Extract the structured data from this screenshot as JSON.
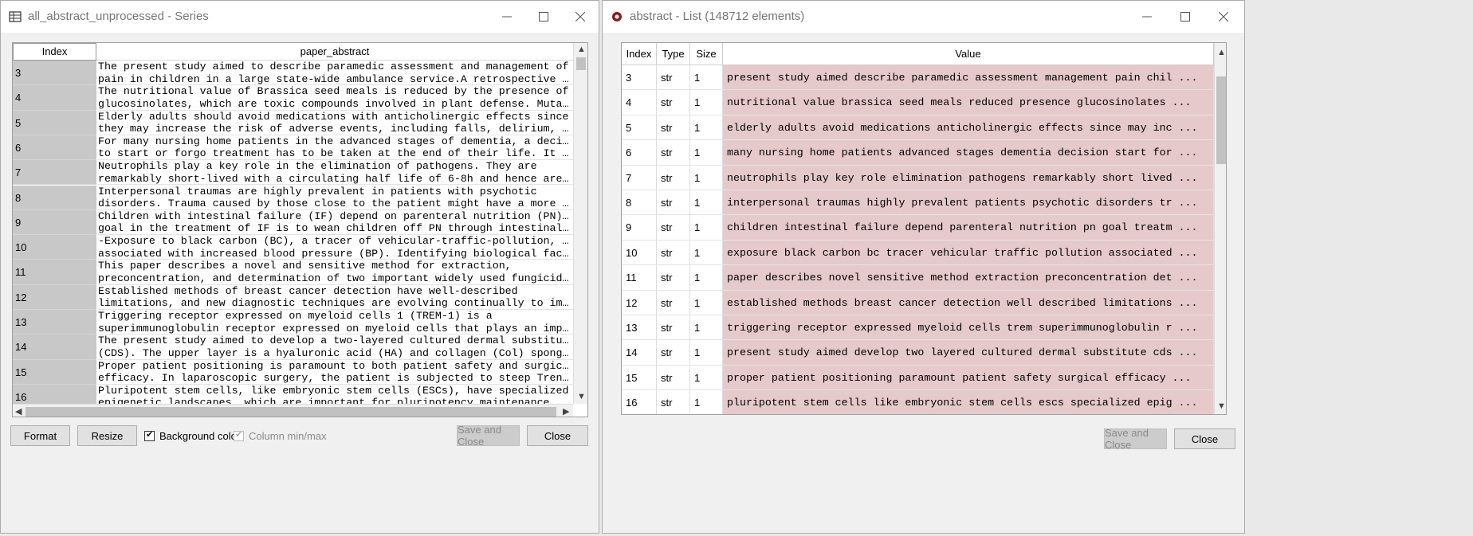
{
  "left_window": {
    "title": "all_abstract_unprocessed - Series",
    "column_headers": [
      "Index",
      "paper_abstract"
    ],
    "rows": [
      {
        "index": "3",
        "line1": "The present study aimed to describe paramedic assessment and management of",
        "line2": "pain in children in a large state-wide ambulance service.A retrospective coho…"
      },
      {
        "index": "4",
        "line1": "The nutritional value of Brassica seed meals is reduced by the presence of",
        "line2": "glucosinolates, which are toxic compounds involved in plant defense. Mutation…"
      },
      {
        "index": "5",
        "line1": "Elderly adults should avoid medications with anticholinergic effects since",
        "line2": "they may increase the risk of adverse events, including falls, delirium, and …"
      },
      {
        "index": "6",
        "line1": "For many nursing home patients in the advanced stages of dementia, a decision",
        "line2": "to start or forgo treatment has to be taken at the end of their life. It is v…"
      },
      {
        "index": "7",
        "line1": "Neutrophils play a key role in the elimination of pathogens. They are",
        "line2": "remarkably short-lived with a circulating half life of 6-8h and hence are pro…"
      },
      {
        "index": "8",
        "line1": "Interpersonal traumas are highly prevalent in patients with psychotic",
        "line2": "disorders. Trauma caused by those close to the patient might have a more prof…"
      },
      {
        "index": "9",
        "line1": "Children with intestinal failure (IF) depend on parenteral nutrition (PN). The",
        "line2": "goal in the treatment of IF is to wean children off PN through intestinal reh…"
      },
      {
        "index": "10",
        "line1": "-Exposure to black carbon (BC), a tracer of vehicular-traffic-pollution, is",
        "line2": "associated with increased blood pressure (BP). Identifying biological factors…"
      },
      {
        "index": "11",
        "line1": "This paper describes a novel and sensitive method for extraction,",
        "line2": "preconcentration, and determination of two important widely used fungicides, …"
      },
      {
        "index": "12",
        "line1": "Established methods of breast cancer detection have well-described",
        "line2": "limitations, and new diagnostic techniques are evolving continually to improv…"
      },
      {
        "index": "13",
        "line1": "Triggering receptor expressed on myeloid cells 1 (TREM-1) is a",
        "line2": "superimmunoglobulin receptor expressed on myeloid cells that plays an importa…"
      },
      {
        "index": "14",
        "line1": "The present study aimed to develop a two-layered cultured dermal substitute",
        "line2": "(CDS). The upper layer is a hyaluronic acid (HA) and collagen (Col) spongy sh…"
      },
      {
        "index": "15",
        "line1": "Proper patient positioning is paramount to both patient safety and surgical",
        "line2": "efficacy. In laparoscopic surgery, the patient is subjected to steep Trendele…"
      },
      {
        "index": "16",
        "line1": "Pluripotent stem cells, like embryonic stem cells (ESCs), have specialized",
        "line2": "epigenetic landscapes, which are important for pluripotency maintenance. Tran…"
      }
    ],
    "buttons": {
      "format": "Format",
      "resize": "Resize",
      "save_close": "Save and Close",
      "close": "Close"
    },
    "checkboxes": {
      "background_color": "Background color",
      "column_minmax": "Column min/max"
    }
  },
  "right_window": {
    "title": "abstract - List (148712 elements)",
    "column_headers": [
      "Index",
      "Type",
      "Size",
      "Value"
    ],
    "rows": [
      {
        "index": "3",
        "type": "str",
        "size": "1",
        "value": "present study aimed describe paramedic assessment management pain chil ..."
      },
      {
        "index": "4",
        "type": "str",
        "size": "1",
        "value": "nutritional value brassica seed meals reduced presence glucosinolates ..."
      },
      {
        "index": "5",
        "type": "str",
        "size": "1",
        "value": "elderly adults avoid medications anticholinergic effects since may inc ..."
      },
      {
        "index": "6",
        "type": "str",
        "size": "1",
        "value": "many nursing home patients advanced stages dementia decision start for ..."
      },
      {
        "index": "7",
        "type": "str",
        "size": "1",
        "value": "neutrophils play key role elimination pathogens remarkably short lived ..."
      },
      {
        "index": "8",
        "type": "str",
        "size": "1",
        "value": "interpersonal traumas highly prevalent patients psychotic disorders tr ..."
      },
      {
        "index": "9",
        "type": "str",
        "size": "1",
        "value": "children intestinal failure depend parenteral nutrition pn goal treatm ..."
      },
      {
        "index": "10",
        "type": "str",
        "size": "1",
        "value": "exposure black carbon bc tracer vehicular traffic pollution associated ..."
      },
      {
        "index": "11",
        "type": "str",
        "size": "1",
        "value": "paper describes novel sensitive method extraction preconcentration det ..."
      },
      {
        "index": "12",
        "type": "str",
        "size": "1",
        "value": "established methods breast cancer detection well described limitations ..."
      },
      {
        "index": "13",
        "type": "str",
        "size": "1",
        "value": "triggering receptor expressed myeloid cells trem superimmunoglobulin r ..."
      },
      {
        "index": "14",
        "type": "str",
        "size": "1",
        "value": "present study aimed develop two layered cultured dermal substitute cds ..."
      },
      {
        "index": "15",
        "type": "str",
        "size": "1",
        "value": "proper patient positioning paramount patient safety surgical efficacy ..."
      },
      {
        "index": "16",
        "type": "str",
        "size": "1",
        "value": "pluripotent stem cells like embryonic stem cells escs specialized epig ..."
      }
    ],
    "buttons": {
      "save_close": "Save and Close",
      "close": "Close"
    }
  },
  "colors": {
    "value_cell_bg": "#e6c9cb",
    "index_cell_bg": "#c8c8c8"
  },
  "icons": {
    "left_title": "table-grid-icon",
    "right_title": "spyder-bug-icon"
  }
}
